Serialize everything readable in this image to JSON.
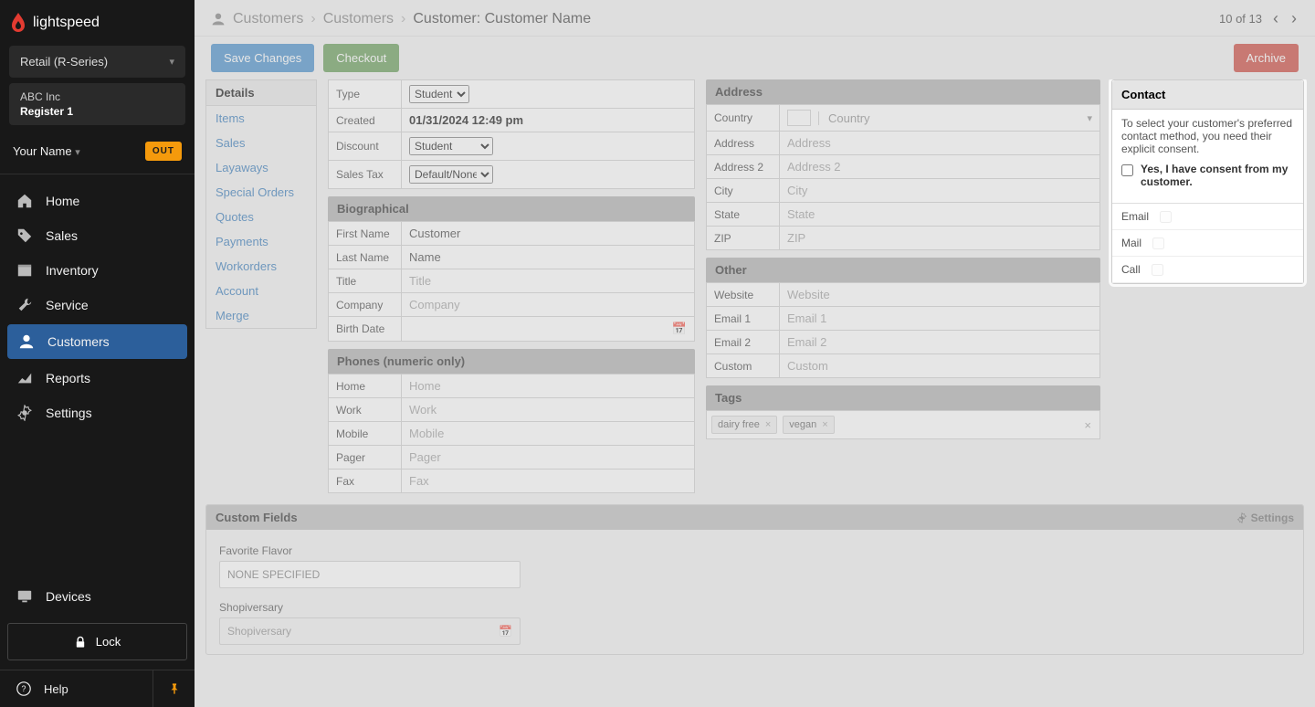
{
  "brand": {
    "name": "lightspeed"
  },
  "retail_selector": "Retail (R-Series)",
  "company": {
    "name": "ABC Inc",
    "register": "Register 1"
  },
  "user": {
    "name": "Your Name",
    "status": "OUT"
  },
  "nav": {
    "home": "Home",
    "sales": "Sales",
    "inventory": "Inventory",
    "service": "Service",
    "customers": "Customers",
    "reports": "Reports",
    "settings": "Settings",
    "devices": "Devices",
    "lock": "Lock",
    "help": "Help"
  },
  "breadcrumbs": {
    "a": "Customers",
    "b": "Customers",
    "c_label": "Customer:",
    "c_value": "Customer Name"
  },
  "pager": {
    "current": "10",
    "of_word": "of",
    "total": "13"
  },
  "buttons": {
    "save": "Save Changes",
    "checkout": "Checkout",
    "archive": "Archive"
  },
  "leftnav": {
    "header": "Details",
    "items": [
      "Items",
      "Sales",
      "Layaways",
      "Special Orders",
      "Quotes",
      "Payments",
      "Workorders",
      "Account",
      "Merge"
    ]
  },
  "fields": {
    "type": {
      "label": "Type",
      "value": "Student"
    },
    "created": {
      "label": "Created",
      "value": "01/31/2024 12:49 pm"
    },
    "discount": {
      "label": "Discount",
      "value": "Student"
    },
    "salestax": {
      "label": "Sales Tax",
      "value": "Default/None"
    },
    "bio_header": "Biographical",
    "first": {
      "label": "First Name",
      "value": "Customer"
    },
    "last": {
      "label": "Last Name",
      "value": "Name"
    },
    "title": {
      "label": "Title",
      "placeholder": "Title"
    },
    "company": {
      "label": "Company",
      "placeholder": "Company"
    },
    "birth": {
      "label": "Birth Date"
    },
    "phones_header": "Phones (numeric only)",
    "phones": {
      "home": {
        "label": "Home",
        "placeholder": "Home"
      },
      "work": {
        "label": "Work",
        "placeholder": "Work"
      },
      "mobile": {
        "label": "Mobile",
        "placeholder": "Mobile"
      },
      "pager": {
        "label": "Pager",
        "placeholder": "Pager"
      },
      "fax": {
        "label": "Fax",
        "placeholder": "Fax"
      }
    }
  },
  "address": {
    "header": "Address",
    "country": {
      "label": "Country",
      "placeholder": "Country"
    },
    "addr1": {
      "label": "Address",
      "placeholder": "Address"
    },
    "addr2": {
      "label": "Address 2",
      "placeholder": "Address 2"
    },
    "city": {
      "label": "City",
      "placeholder": "City"
    },
    "state": {
      "label": "State",
      "placeholder": "State"
    },
    "zip": {
      "label": "ZIP",
      "placeholder": "ZIP"
    }
  },
  "other": {
    "header": "Other",
    "website": {
      "label": "Website",
      "placeholder": "Website"
    },
    "email1": {
      "label": "Email 1",
      "placeholder": "Email 1"
    },
    "email2": {
      "label": "Email 2",
      "placeholder": "Email 2"
    },
    "custom": {
      "label": "Custom",
      "placeholder": "Custom"
    }
  },
  "tags": {
    "header": "Tags",
    "items": [
      "dairy free",
      "vegan"
    ]
  },
  "contact": {
    "header": "Contact",
    "note": "To select your customer's preferred contact method, you need their explicit consent.",
    "consent": "Yes, I have consent from my customer.",
    "email": "Email",
    "mail": "Mail",
    "call": "Call"
  },
  "custom_fields": {
    "header": "Custom Fields",
    "settings": "Settings",
    "flavor": {
      "label": "Favorite Flavor",
      "placeholder": "NONE SPECIFIED"
    },
    "shopiversary": {
      "label": "Shopiversary",
      "placeholder": "Shopiversary"
    }
  }
}
